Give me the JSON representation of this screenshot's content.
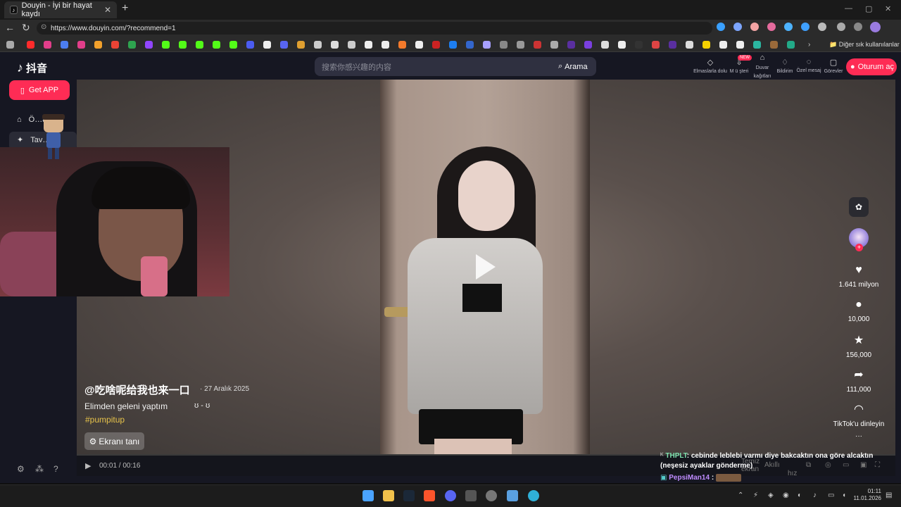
{
  "browser": {
    "tab_title": "Douyin - İyi bir hayat kaydı",
    "tab_close": "✕",
    "new_tab": "+",
    "url": "https://www.douyin.com/?recommend=1",
    "other_bookmarks": "Diğer sık kullanılanlar",
    "win_min": "—",
    "win_max": "▢",
    "win_close": "✕",
    "back": "←",
    "reload": "↻"
  },
  "header": {
    "logo_text": "抖音",
    "search_placeholder": "搜索你感兴趣的内容",
    "search_button": "Arama",
    "icons": [
      {
        "label": "Elmaslarla dolu",
        "glyph": "◇"
      },
      {
        "label": "M ü şteri",
        "glyph": "⇩"
      },
      {
        "label": "Duvar kağıtları",
        "glyph": "⌂"
      },
      {
        "label": "Bildirim",
        "glyph": "♢"
      },
      {
        "label": "Özel mesaj",
        "glyph": "◌"
      },
      {
        "label": "Görevler",
        "glyph": "▢"
      }
    ],
    "new_badge": "NEW",
    "login": "Oturum aç"
  },
  "sidebar": {
    "get_app": "Get APP",
    "items": [
      {
        "label": "Ö…anları"
      },
      {
        "label": "Tav…dili"
      }
    ]
  },
  "video": {
    "author": "@吃啥呢给我也来一口",
    "date": "· 27 Aralık 2025",
    "description": "Elimden geleni yaptım",
    "emoticon": "ʊ - ʊ",
    "hashtag": "#pumpitup",
    "identify_button": "Ekranı tanı",
    "time": "00:01 / 00:16",
    "controls_right": [
      "Temiz ekran",
      "Akıllı",
      "hız"
    ]
  },
  "actions": {
    "likes": "1.641 milyon",
    "comments": "10,000",
    "favorites": "156,000",
    "shares": "111,000",
    "listen": "TikTok'u dinleyin",
    "more": "···"
  },
  "chat": {
    "msg1_user": "THPLT",
    "msg1_text": ": cebinde leblebi varmı diye bakcaktın ona göre alcaktın (neşesiz ayaklar gönderme)",
    "msg2_user": "PepsiMan14",
    "msg2_sep": ":"
  },
  "taskbar": {
    "time": "01:11",
    "date": "11.01.2026"
  },
  "colors": {
    "accent": "#fe2c55",
    "page_bg": "#161722",
    "hashtag": "#e6c24a",
    "chat_user1": "#7fe3b0",
    "chat_user2": "#c08cff"
  }
}
